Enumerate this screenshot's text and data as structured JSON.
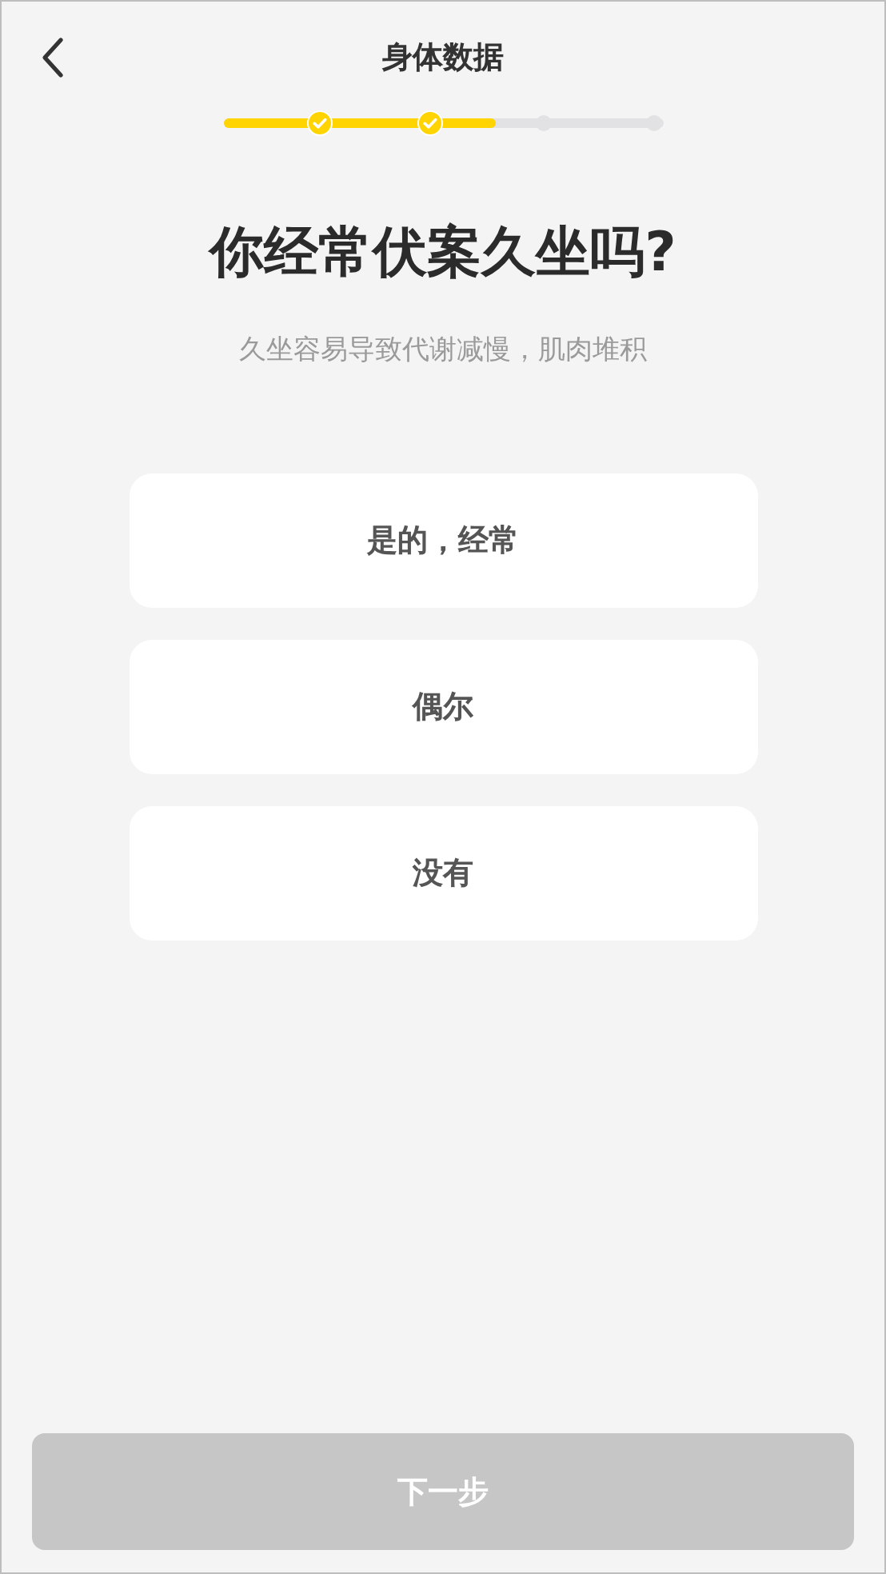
{
  "header": {
    "title": "身体数据"
  },
  "progress": {
    "level": 0.62,
    "steps": [
      {
        "done": true
      },
      {
        "done": true
      },
      {
        "done": false
      },
      {
        "done": false
      }
    ]
  },
  "question": {
    "title": "你经常伏案久坐吗?",
    "subtitle": "久坐容易导致代谢减慢，肌肉堆积"
  },
  "options": [
    {
      "label": "是的，经常",
      "selected": false
    },
    {
      "label": "偶尔",
      "selected": false
    },
    {
      "label": "没有",
      "selected": false
    }
  ],
  "next_button": {
    "label": "下一步",
    "disabled": true
  }
}
